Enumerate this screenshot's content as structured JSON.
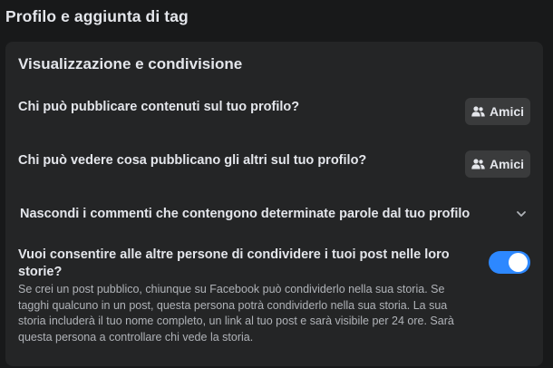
{
  "page": {
    "title": "Profilo e aggiunta di tag"
  },
  "section": {
    "title": "Visualizzazione e condivisione",
    "rows": [
      {
        "label": "Chi può pubblicare contenuti sul tuo profilo?",
        "button_label": "Amici",
        "button_icon": "friends-icon"
      },
      {
        "label": "Chi può vedere cosa pubblicano gli altri sul tuo profilo?",
        "button_label": "Amici",
        "button_icon": "friends-icon"
      }
    ],
    "expandable": {
      "label": "Nascondi i commenti che contengono determinate parole dal tuo profilo",
      "icon": "chevron-down-icon"
    },
    "toggle_row": {
      "label": "Vuoi consentire alle altre persone di condividere i tuoi post nelle loro storie?",
      "description": "Se crei un post pubblico, chiunque su Facebook può condividerlo nella sua storia. Se tagghi qualcuno in un post, questa persona potrà condividerlo nella sua storia. La sua storia includerà il tuo nome completo, un link al tuo post e sarà visibile per 24 ore. Sarà questa persona a controllare chi vede la storia.",
      "enabled": true
    }
  },
  "colors": {
    "background": "#18191a",
    "card": "#242526",
    "button": "#3a3b3c",
    "toggle_on": "#2d88ff",
    "text_primary": "#e4e6eb",
    "text_secondary": "#b0b3b8"
  }
}
